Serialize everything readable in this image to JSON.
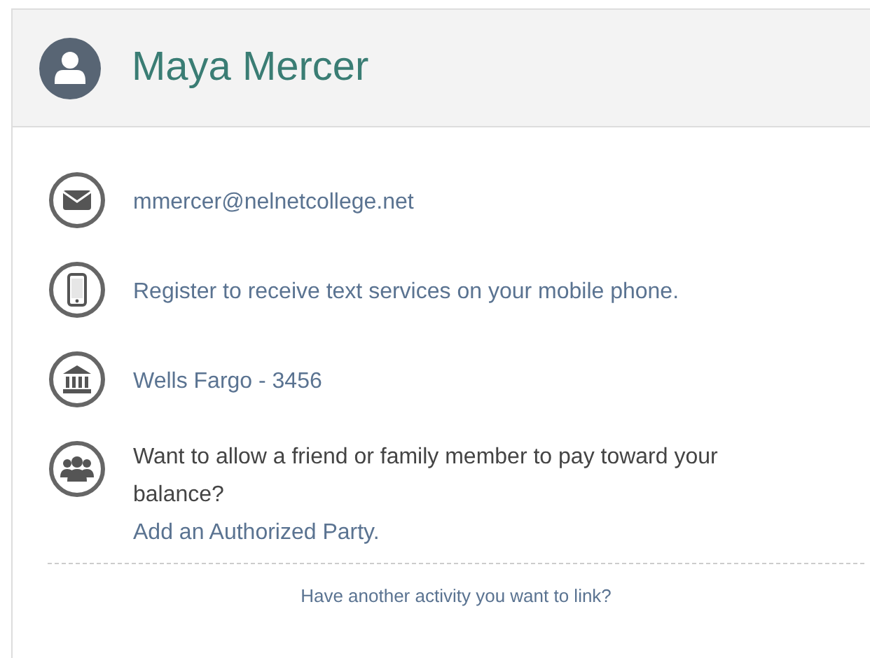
{
  "header": {
    "name": "Maya Mercer"
  },
  "items": [
    {
      "kind": "email",
      "text": "mmercer@nelnetcollege.net"
    },
    {
      "kind": "phone",
      "text": "Register to receive text services on your mobile phone."
    },
    {
      "kind": "bank",
      "text": "Wells Fargo - 3456"
    },
    {
      "kind": "party",
      "text": "Want to allow a friend or family member to pay toward your balance?",
      "link": "Add an Authorized Party."
    }
  ],
  "footer_link": "Have another activity you want to link?"
}
